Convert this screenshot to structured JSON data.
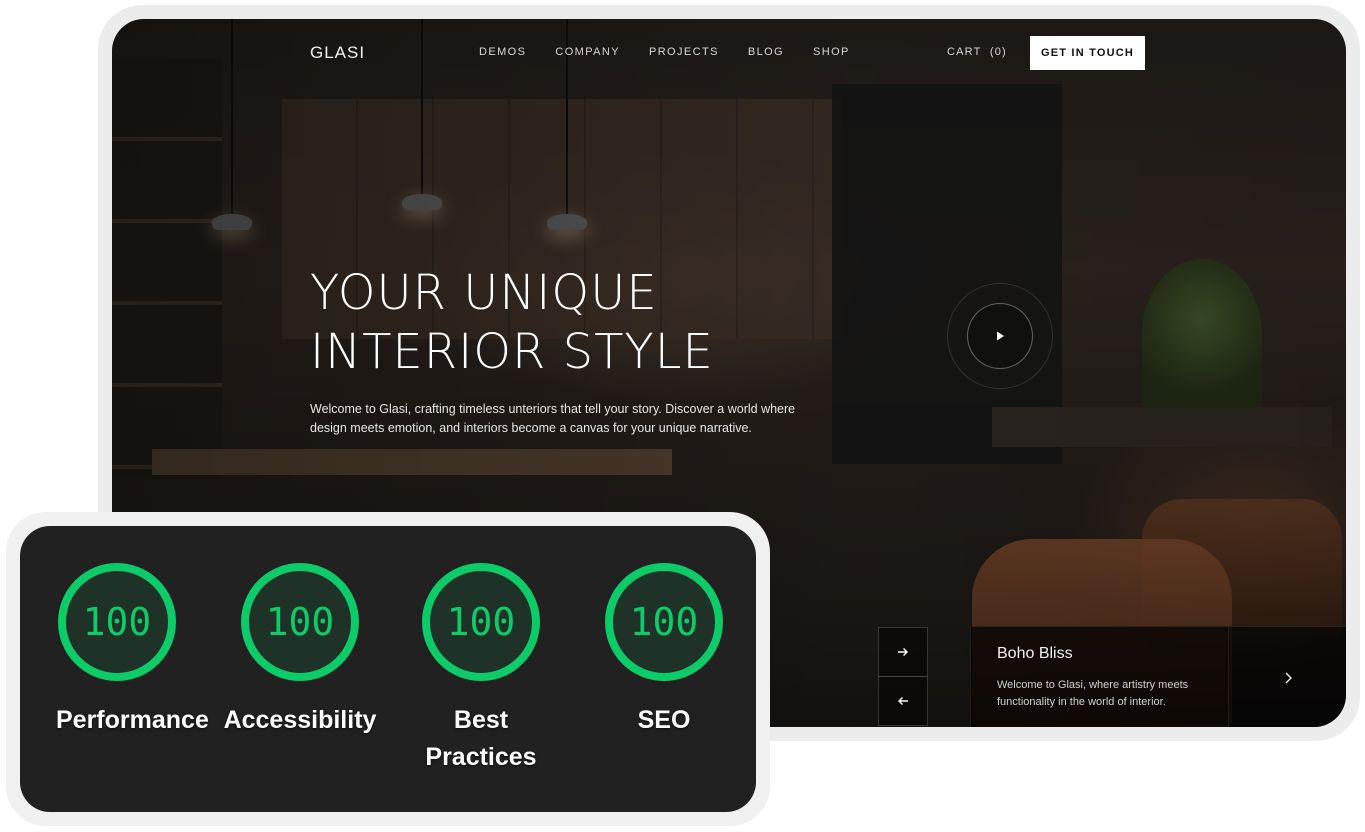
{
  "site": {
    "logo": "GLASI",
    "nav": [
      "DEMOS",
      "COMPANY",
      "PROJECTS",
      "BLOG",
      "SHOP"
    ],
    "cart": "CART  (0)",
    "cta": "GET IN TOUCH",
    "hero": {
      "title_line1": "YOUR UNIQUE",
      "title_line2": "INTERIOR STYLE",
      "subtitle": "Welcome to Glasi, crafting timeless unteriors that tell your story. Discover a world where design meets emotion, and interiors become a canvas for your unique narrative."
    },
    "slide": {
      "title": "Boho Bliss",
      "description": "Welcome to Glasi, where artistry meets functionality in the world of interior."
    }
  },
  "lighthouse": {
    "accent_color": "#0ccc6a",
    "scores": [
      {
        "value": "100",
        "label": "Performance",
        "score": 100
      },
      {
        "value": "100",
        "label": "Accessibility",
        "score": 100
      },
      {
        "value": "100",
        "label": "Best Practices",
        "score": 100
      },
      {
        "value": "100",
        "label": "SEO",
        "score": 100
      }
    ]
  },
  "icons": {
    "play": "play-icon",
    "next": "arrow-right-icon",
    "prev": "arrow-left-icon",
    "slide_next": "chevron-right-icon"
  }
}
